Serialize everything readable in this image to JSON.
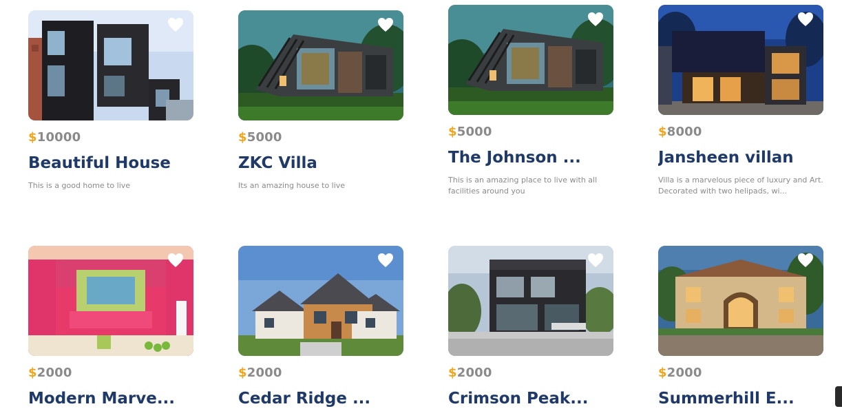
{
  "currency_symbol": "$",
  "listings": [
    {
      "price": "10000",
      "title": "Beautiful House",
      "description": "This is a good home to live",
      "image_icon": "modern-black-house-photo",
      "favorite_icon": "heart-icon"
    },
    {
      "price": "5000",
      "title": "ZKC Villa",
      "description": "Its an amazing house to live",
      "image_icon": "glass-villa-forest-photo",
      "favorite_icon": "heart-icon"
    },
    {
      "price": "5000",
      "title": "The Johnson ...",
      "description": "This is an amazing place to live with all facilities around you",
      "image_icon": "glass-villa-forest-photo",
      "favorite_icon": "heart-icon"
    },
    {
      "price": "8000",
      "title": "Jansheen villan",
      "description": "Villa is a marvelous piece of luxury and Art. Decorated with two helipads, wi...",
      "image_icon": "night-modern-villa-photo",
      "favorite_icon": "heart-icon"
    },
    {
      "price": "2000",
      "title": "Modern Marve...",
      "description": "",
      "image_icon": "pink-kitchen-photo",
      "favorite_icon": "heart-icon"
    },
    {
      "price": "2000",
      "title": "Cedar Ridge ...",
      "description": "",
      "image_icon": "cedar-family-house-photo",
      "favorite_icon": "heart-icon"
    },
    {
      "price": "2000",
      "title": "Crimson Peak...",
      "description": "",
      "image_icon": "black-cube-house-photo",
      "favorite_icon": "heart-icon"
    },
    {
      "price": "2000",
      "title": "Summerhill E...",
      "description": "",
      "image_icon": "mediterranean-estate-photo",
      "favorite_icon": "heart-icon"
    }
  ],
  "colors": {
    "title": "#1f3a68",
    "price": "#8a8a8a",
    "currency": "#f2a51a",
    "description": "#8a8a8a"
  }
}
